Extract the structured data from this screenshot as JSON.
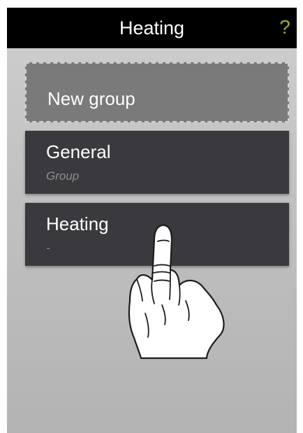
{
  "header": {
    "title": "Heating",
    "help_label": "?"
  },
  "groups": [
    {
      "title": "New group"
    },
    {
      "title": "General",
      "subtitle": "Group"
    },
    {
      "title": "Heating",
      "subtitle": "-"
    }
  ],
  "colors": {
    "header_bg": "#000000",
    "help_accent": "#a2ab2e",
    "card_bg": "#39393e",
    "new_card_bg": "#7a7a7a",
    "screen_bg": "#c2c2c2"
  },
  "overlay": {
    "icon": "pointing-hand-icon"
  }
}
